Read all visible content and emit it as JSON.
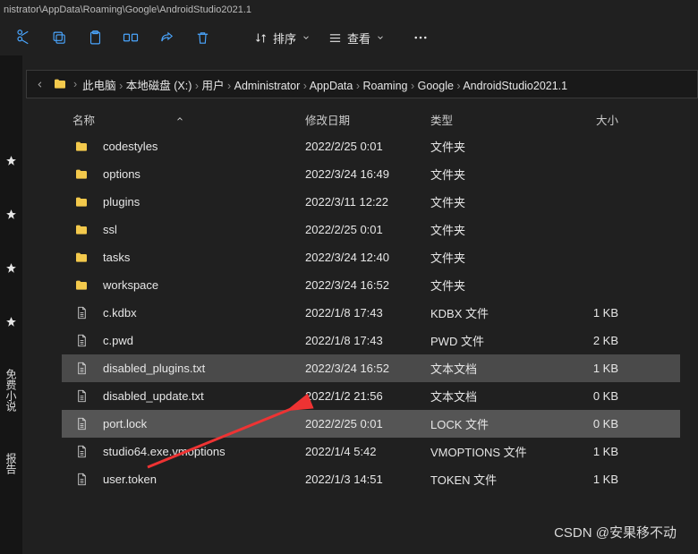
{
  "window": {
    "title_path": "nistrator\\AppData\\Roaming\\Google\\AndroidStudio2021.1"
  },
  "toolbar": {
    "sort_label": "排序",
    "view_label": "查看"
  },
  "breadcrumb": {
    "items": [
      "此电脑",
      "本地磁盘 (X:)",
      "用户",
      "Administrator",
      "AppData",
      "Roaming",
      "Google",
      "AndroidStudio2021.1"
    ]
  },
  "rail": {
    "items": [
      "免费小说",
      "报告"
    ]
  },
  "headers": {
    "name": "名称",
    "date": "修改日期",
    "type": "类型",
    "size": "大小"
  },
  "rows": [
    {
      "icon": "folder",
      "name": "codestyles",
      "date": "2022/2/25 0:01",
      "type": "文件夹",
      "size": ""
    },
    {
      "icon": "folder",
      "name": "options",
      "date": "2022/3/24 16:49",
      "type": "文件夹",
      "size": ""
    },
    {
      "icon": "folder",
      "name": "plugins",
      "date": "2022/3/11 12:22",
      "type": "文件夹",
      "size": ""
    },
    {
      "icon": "folder",
      "name": "ssl",
      "date": "2022/2/25 0:01",
      "type": "文件夹",
      "size": ""
    },
    {
      "icon": "folder",
      "name": "tasks",
      "date": "2022/3/24 12:40",
      "type": "文件夹",
      "size": ""
    },
    {
      "icon": "folder",
      "name": "workspace",
      "date": "2022/3/24 16:52",
      "type": "文件夹",
      "size": ""
    },
    {
      "icon": "file",
      "name": "c.kdbx",
      "date": "2022/1/8 17:43",
      "type": "KDBX 文件",
      "size": "1 KB"
    },
    {
      "icon": "file",
      "name": "c.pwd",
      "date": "2022/1/8 17:43",
      "type": "PWD 文件",
      "size": "2 KB"
    },
    {
      "icon": "file",
      "name": "disabled_plugins.txt",
      "date": "2022/3/24 16:52",
      "type": "文本文档",
      "size": "1 KB",
      "selected": true
    },
    {
      "icon": "file",
      "name": "disabled_update.txt",
      "date": "2022/1/2 21:56",
      "type": "文本文档",
      "size": "0 KB"
    },
    {
      "icon": "file",
      "name": "port.lock",
      "date": "2022/2/25 0:01",
      "type": "LOCK 文件",
      "size": "0 KB",
      "focused": true
    },
    {
      "icon": "file",
      "name": "studio64.exe.vmoptions",
      "date": "2022/1/4 5:42",
      "type": "VMOPTIONS 文件",
      "size": "1 KB"
    },
    {
      "icon": "file",
      "name": "user.token",
      "date": "2022/1/3 14:51",
      "type": "TOKEN 文件",
      "size": "1 KB"
    }
  ],
  "watermark": "CSDN @安果移不动"
}
